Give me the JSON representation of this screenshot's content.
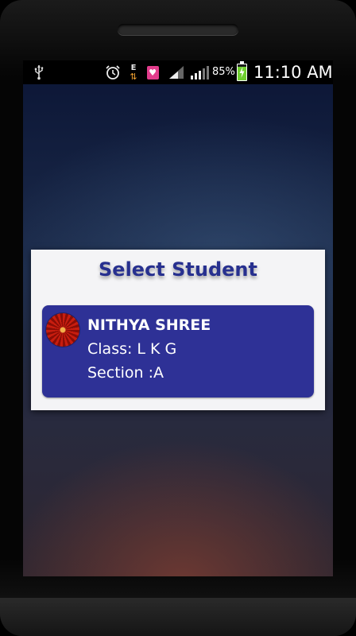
{
  "status_bar": {
    "battery_percent": "85%",
    "battery_level": 0.85,
    "time": "11:10 AM",
    "icons": [
      "usb-icon",
      "alarm-icon",
      "data-transfer-icon",
      "health-app-icon",
      "signal-icon",
      "signal-icon",
      "battery-charging-icon"
    ],
    "icon_glyphs": {
      "usb": "⌁",
      "alarm": "⏰",
      "data_letter": "E",
      "data_arrows": "⇅",
      "health": "♥"
    }
  },
  "dialog": {
    "title": "Select Student",
    "students": [
      {
        "name": "NITHYA SHREE",
        "class": "Class: L K G",
        "section": "Section :A"
      }
    ]
  },
  "colors": {
    "title": "#27308f",
    "card": "#2e3196",
    "dialog_bg": "#f4f4f6"
  }
}
